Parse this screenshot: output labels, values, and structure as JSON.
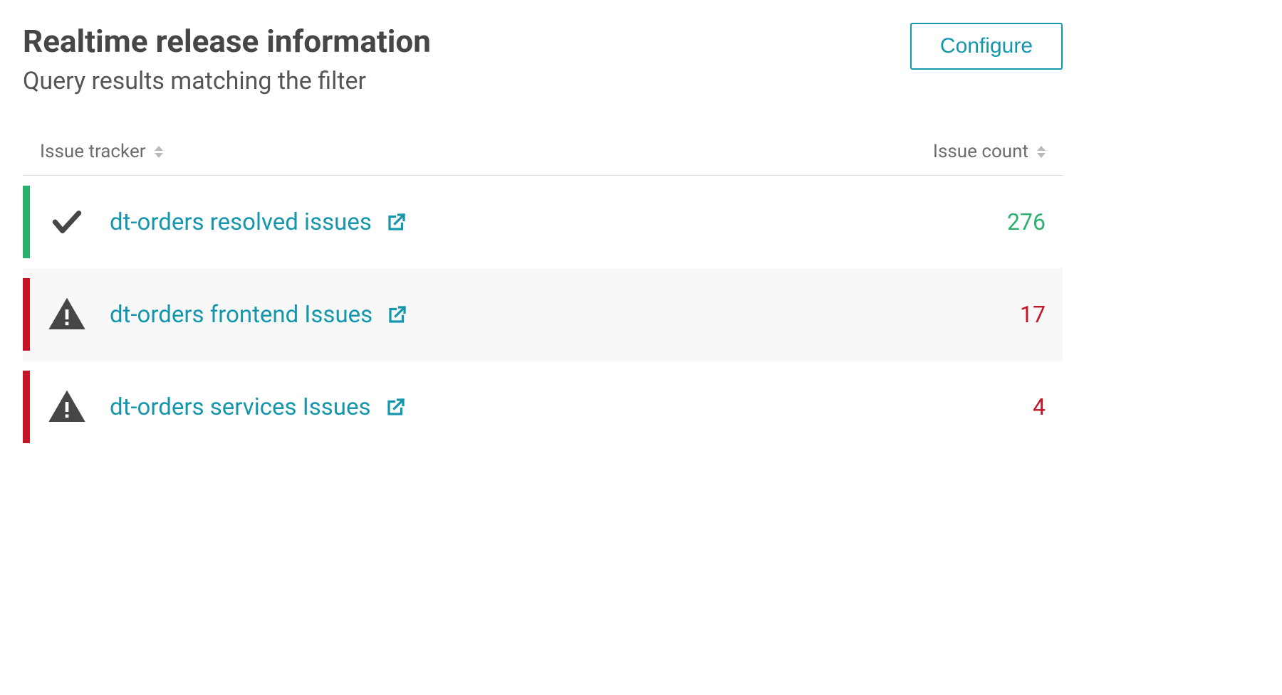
{
  "header": {
    "title": "Realtime release information",
    "subtitle": "Query results matching the filter",
    "configure_label": "Configure"
  },
  "table": {
    "columns": {
      "tracker": "Issue tracker",
      "count": "Issue count"
    },
    "rows": [
      {
        "status": "ok",
        "label": "dt-orders resolved issues",
        "count": "276"
      },
      {
        "status": "error",
        "label": "dt-orders frontend Issues",
        "count": "17"
      },
      {
        "status": "error",
        "label": "dt-orders services Issues",
        "count": "4"
      }
    ]
  },
  "colors": {
    "accent": "#1496ac",
    "success": "#2ab06f",
    "danger": "#c41425"
  }
}
